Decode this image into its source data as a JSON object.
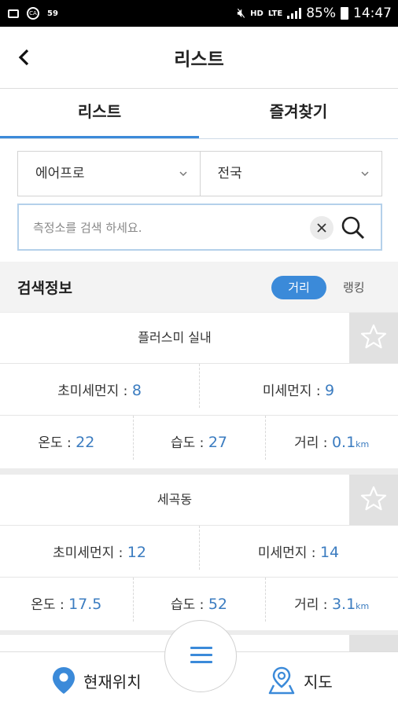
{
  "status_bar": {
    "left_number": "59",
    "right_labels": [
      "HD",
      "LTE"
    ],
    "battery": "85%",
    "time": "14:47"
  },
  "app_bar": {
    "title": "리스트"
  },
  "tabs": [
    {
      "label": "리스트",
      "active": true
    },
    {
      "label": "즐겨찾기",
      "active": false
    }
  ],
  "filters": {
    "brand_select": "에어프로",
    "region_select": "전국",
    "search_placeholder": "측정소를 검색 하세요."
  },
  "search_info": {
    "label": "검색정보",
    "sort_distance": "거리",
    "sort_ranking": "랭킹"
  },
  "stations": [
    {
      "name": "플러스미 실내",
      "ultrafine_label": "초미세먼지 : ",
      "ultrafine": "8",
      "fine_label": "미세먼지 : ",
      "fine": "9",
      "temp_label": "온도 : ",
      "temp": "22",
      "humidity_label": "습도 : ",
      "humidity": "27",
      "distance_label": "거리 : ",
      "distance": "0.1",
      "distance_unit": "km"
    },
    {
      "name": "세곡동",
      "ultrafine_label": "초미세먼지 : ",
      "ultrafine": "12",
      "fine_label": "미세먼지 : ",
      "fine": "14",
      "temp_label": "온도 : ",
      "temp": "17.5",
      "humidity_label": "습도 : ",
      "humidity": "52",
      "distance_label": "거리 : ",
      "distance": "3.1",
      "distance_unit": "km"
    }
  ],
  "bottom_nav": {
    "current_location": "현재위치",
    "map": "지도"
  },
  "colors": {
    "accent": "#3b8ad9",
    "value": "#3b7cc0"
  }
}
